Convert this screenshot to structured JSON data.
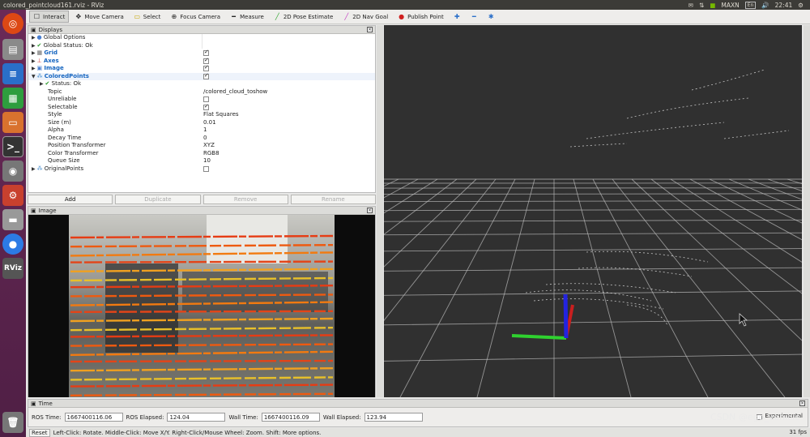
{
  "window": {
    "title": "colored_pointcloud161.rviz - RViz"
  },
  "system": {
    "icons": [
      "mail-icon",
      "network-icon"
    ],
    "gpu_label": "MAXN",
    "lang": "En",
    "volume": "volume-icon",
    "time": "22:41",
    "gear": "gear-icon"
  },
  "toolbar": {
    "tools": [
      {
        "label": "Interact",
        "icon": "interact-icon",
        "active": true
      },
      {
        "label": "Move Camera",
        "icon": "move-camera-icon",
        "active": false
      },
      {
        "label": "Select",
        "icon": "select-icon",
        "active": false
      },
      {
        "label": "Focus Camera",
        "icon": "focus-camera-icon",
        "active": false
      },
      {
        "label": "Measure",
        "icon": "measure-icon",
        "active": false
      },
      {
        "label": "2D Pose Estimate",
        "icon": "pose-estimate-icon",
        "active": false
      },
      {
        "label": "2D Nav Goal",
        "icon": "nav-goal-icon",
        "active": false
      },
      {
        "label": "Publish Point",
        "icon": "publish-point-icon",
        "active": false
      }
    ]
  },
  "displays": {
    "title": "Displays",
    "rows": [
      {
        "label": "Global Options",
        "value": "",
        "indent": 0,
        "expander": true,
        "icon": "globe-icon",
        "bold": false
      },
      {
        "label": "Global Status: Ok",
        "value": "",
        "indent": 0,
        "expander": true,
        "icon": "check-icon",
        "bold": false
      },
      {
        "label": "Grid",
        "value": "",
        "check": true,
        "indent": 0,
        "expander": true,
        "icon": "grid-icon",
        "bold": true
      },
      {
        "label": "Axes",
        "value": "",
        "check": true,
        "indent": 0,
        "expander": true,
        "icon": "axes-icon",
        "bold": true
      },
      {
        "label": "Image",
        "value": "",
        "check": true,
        "indent": 0,
        "expander": true,
        "icon": "image-icon",
        "bold": true
      },
      {
        "label": "ColoredPoints",
        "value": "",
        "check": true,
        "indent": 0,
        "expander": true,
        "icon": "pointcloud-icon",
        "bold": true
      },
      {
        "label": "Status: Ok",
        "value": "",
        "indent": 1,
        "expander": true,
        "icon": "check-icon",
        "bold": false
      },
      {
        "label": "Topic",
        "value": "/colored_cloud_toshow",
        "indent": 1,
        "bold": false
      },
      {
        "label": "Unreliable",
        "value": "",
        "check": false,
        "indent": 1,
        "bold": false
      },
      {
        "label": "Selectable",
        "value": "",
        "check": true,
        "indent": 1,
        "bold": false
      },
      {
        "label": "Style",
        "value": "Flat Squares",
        "indent": 1,
        "bold": false
      },
      {
        "label": "Size (m)",
        "value": "0.01",
        "indent": 1,
        "bold": false
      },
      {
        "label": "Alpha",
        "value": "1",
        "indent": 1,
        "bold": false
      },
      {
        "label": "Decay Time",
        "value": "0",
        "indent": 1,
        "bold": false
      },
      {
        "label": "Position Transformer",
        "value": "XYZ",
        "indent": 1,
        "bold": false
      },
      {
        "label": "Color Transformer",
        "value": "RGB8",
        "indent": 1,
        "bold": false
      },
      {
        "label": "Queue Size",
        "value": "10",
        "indent": 1,
        "bold": false
      },
      {
        "label": "OriginalPoints",
        "value": "",
        "check": false,
        "indent": 0,
        "expander": true,
        "icon": "pointcloud-icon",
        "bold": false
      }
    ],
    "buttons": [
      {
        "label": "Add",
        "enabled": true
      },
      {
        "label": "Duplicate",
        "enabled": false
      },
      {
        "label": "Remove",
        "enabled": false
      },
      {
        "label": "Rename",
        "enabled": false
      }
    ]
  },
  "image_panel": {
    "title": "Image"
  },
  "time_panel": {
    "title": "Time",
    "ros_time_label": "ROS Time:",
    "ros_time": "1667400116.06",
    "ros_elapsed_label": "ROS Elapsed:",
    "ros_elapsed": "124.04",
    "wall_time_label": "Wall Time:",
    "wall_time": "1667400116.09",
    "wall_elapsed_label": "Wall Elapsed:",
    "wall_elapsed": "123.94",
    "experimental_label": "Experimental"
  },
  "statusbar": {
    "reset_label": "Reset",
    "hint": "Left-Click: Rotate. Middle-Click: Move X/Y. Right-Click/Mouse Wheel: Zoom. Shift: More options.",
    "fps": "31 fps"
  },
  "watermark": "CSDN @ego_vehicle",
  "colors": {
    "grid": "#bfbfbf",
    "axis_x": "#d32020",
    "axis_y": "#2fd12f",
    "axis_z": "#2323e0"
  }
}
